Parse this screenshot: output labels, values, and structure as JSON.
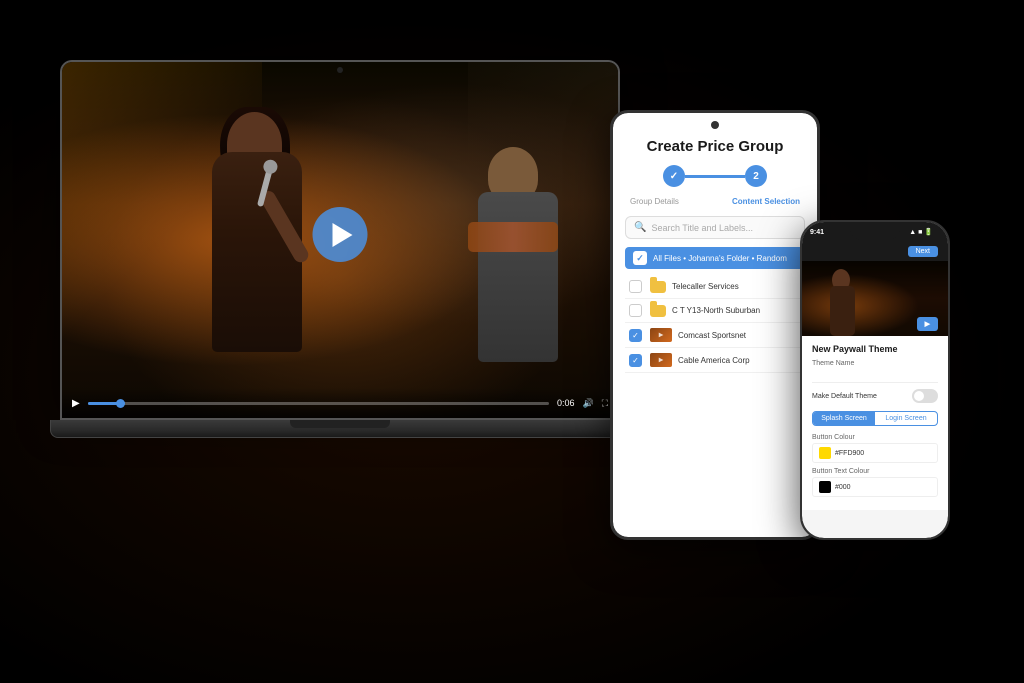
{
  "background": {
    "color": "#000000"
  },
  "laptop": {
    "play_button_label": "▶",
    "time_display": "0:06",
    "progress_percent": 8
  },
  "tablet": {
    "title": "Create Price Group",
    "step1_label": "Group Details",
    "step2_label": "Content Selection",
    "search_placeholder": "Search Title and Labels...",
    "breadcrumb_text": "All Files • Johanna's Folder • Random",
    "files": [
      {
        "name": "Telecaller Services",
        "type": "folder",
        "checked": false
      },
      {
        "name": "C T Y13-North Suburban",
        "type": "folder",
        "checked": false
      },
      {
        "name": "Comcast Sportsnet",
        "type": "video",
        "checked": true
      },
      {
        "name": "Cable America Corp",
        "type": "video",
        "checked": true
      }
    ]
  },
  "phone": {
    "status_time": "9:41",
    "status_icons": "▲▲ ■",
    "header_button": "Next",
    "section_title": "New Paywall Theme",
    "theme_name_label": "Theme Name",
    "theme_name_value": "",
    "default_toggle_label": "Make Default Theme",
    "tab1": "Splash Screen",
    "tab2": "Login Screen",
    "button_color_label": "Button Colour",
    "button_color_value": "#FFD900",
    "button_text_color_label": "Button Text Colour",
    "button_text_color_value": "#000"
  }
}
